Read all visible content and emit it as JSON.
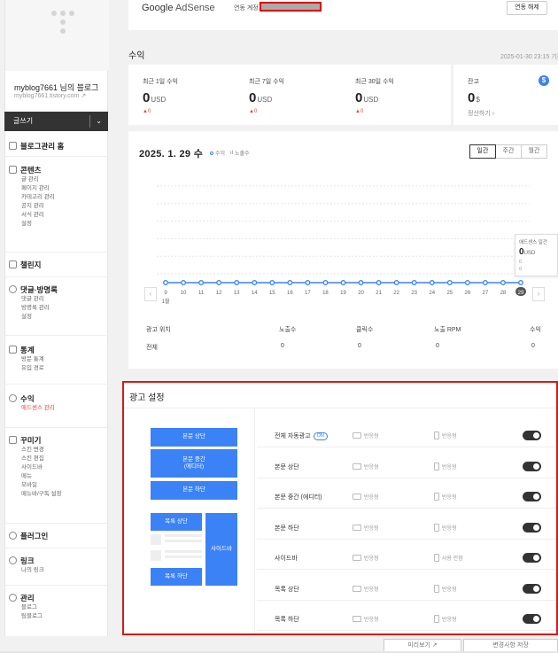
{
  "sidebar": {
    "blog_name": "myblog7661 님의 블로그",
    "blog_url": "myblog7661.tistory.com",
    "write_label": "글쓰기",
    "home_label": "블로그관리 홈",
    "groups": [
      {
        "title": "콘텐츠",
        "icon": "document-icon",
        "items": [
          "글 관리",
          "페이지 관리",
          "카테고리 관리",
          "공지 관리",
          "서식 관리",
          "설정"
        ]
      },
      {
        "title": "챌린지",
        "icon": "flag-icon",
        "items": []
      },
      {
        "title": "댓글·방명록",
        "icon": "comment-icon",
        "items": [
          "댓글 관리",
          "방명록 관리",
          "설정"
        ]
      },
      {
        "title": "통계",
        "icon": "bar-chart-icon",
        "items": [
          "방문 통계",
          "유입 경로"
        ]
      },
      {
        "title": "수익",
        "icon": "coin-icon",
        "items": [
          "애드센스 관리"
        ]
      },
      {
        "title": "꾸미기",
        "icon": "palette-icon",
        "items": [
          "스킨 변경",
          "스킨 편집",
          "사이드바",
          "메뉴",
          "모바일",
          "메뉴바/구독 설정"
        ]
      },
      {
        "title": "플러그인",
        "icon": "plugin-icon",
        "items": []
      },
      {
        "title": "링크",
        "icon": "link-icon",
        "items": [
          "나의 링크"
        ]
      },
      {
        "title": "관리",
        "icon": "gear-icon",
        "items": [
          "블로그",
          "팀블로그"
        ]
      }
    ]
  },
  "adsense": {
    "logo_google": "Google",
    "logo_product": "AdSense",
    "linked_label": "연동 계정",
    "unlink_label": "연동 해제"
  },
  "revenue": {
    "title": "수익",
    "updated": "2025-01-30 23:15 기준",
    "stats": [
      {
        "label": "최근 1일 수익",
        "value": "0",
        "unit": "USD",
        "delta": "▲0"
      },
      {
        "label": "최근 7일 수익",
        "value": "0",
        "unit": "USD",
        "delta": "▲0"
      },
      {
        "label": "최근 30일 수익",
        "value": "0",
        "unit": "USD",
        "delta": "▲0"
      }
    ],
    "balance": {
      "label": "잔고",
      "value": "0",
      "unit": "$",
      "settle_label": "정산하기 ›",
      "icon": "dollar-icon"
    }
  },
  "chart": {
    "date": "2025. 1. 29 수",
    "legend_revenue": "수익",
    "legend_impressions": "노출수",
    "periods": [
      "일간",
      "주간",
      "월간"
    ],
    "active_period": "일간",
    "month_label": "1월",
    "tooltip": {
      "title": "애드센스 일간",
      "value": "0",
      "unit": "USD",
      "a": "0",
      "b": "0"
    },
    "table": {
      "headers": [
        "광고 위치",
        "노출수",
        "클릭수",
        "노출 RPM",
        "수익"
      ],
      "row": [
        "전체",
        "0",
        "0",
        "0",
        "0"
      ]
    }
  },
  "chart_data": {
    "type": "line",
    "x": [
      "9",
      "10",
      "11",
      "12",
      "13",
      "14",
      "15",
      "16",
      "17",
      "18",
      "19",
      "20",
      "21",
      "22",
      "23",
      "24",
      "25",
      "26",
      "27",
      "28",
      "29"
    ],
    "series": [
      {
        "name": "수익",
        "values": [
          0,
          0,
          0,
          0,
          0,
          0,
          0,
          0,
          0,
          0,
          0,
          0,
          0,
          0,
          0,
          0,
          0,
          0,
          0,
          0,
          0
        ]
      }
    ],
    "selected": "29",
    "color": "#3b82f6"
  },
  "ad_settings": {
    "title": "광고 설정",
    "preview": {
      "top": "본문 상단",
      "middle": "본문 중간\n(에디터)",
      "bottom": "본문 하단",
      "list_top": "목록 상단",
      "list_bottom": "목록 하단",
      "sidebar": "사이드바"
    },
    "rows": [
      {
        "label": "전체 자동광고",
        "badge": "ON",
        "pc": "반응형",
        "mobile": "반응형"
      },
      {
        "label": "본문 상단",
        "pc": "반응형",
        "mobile": "반응형"
      },
      {
        "label": "본문 중간 (에디터)",
        "pc": "반응형",
        "mobile": "반응형"
      },
      {
        "label": "본문 하단",
        "pc": "반응형",
        "mobile": "반응형"
      },
      {
        "label": "사이드바",
        "pc": "반응형",
        "mobile": "사용 안함"
      },
      {
        "label": "목록 상단",
        "pc": "반응형",
        "mobile": "반응형"
      },
      {
        "label": "목록 하단",
        "pc": "반응형",
        "mobile": "반응형"
      }
    ]
  },
  "footer": {
    "preview_label": "미리보기 ↗",
    "save_label": "변경사항 저장"
  }
}
